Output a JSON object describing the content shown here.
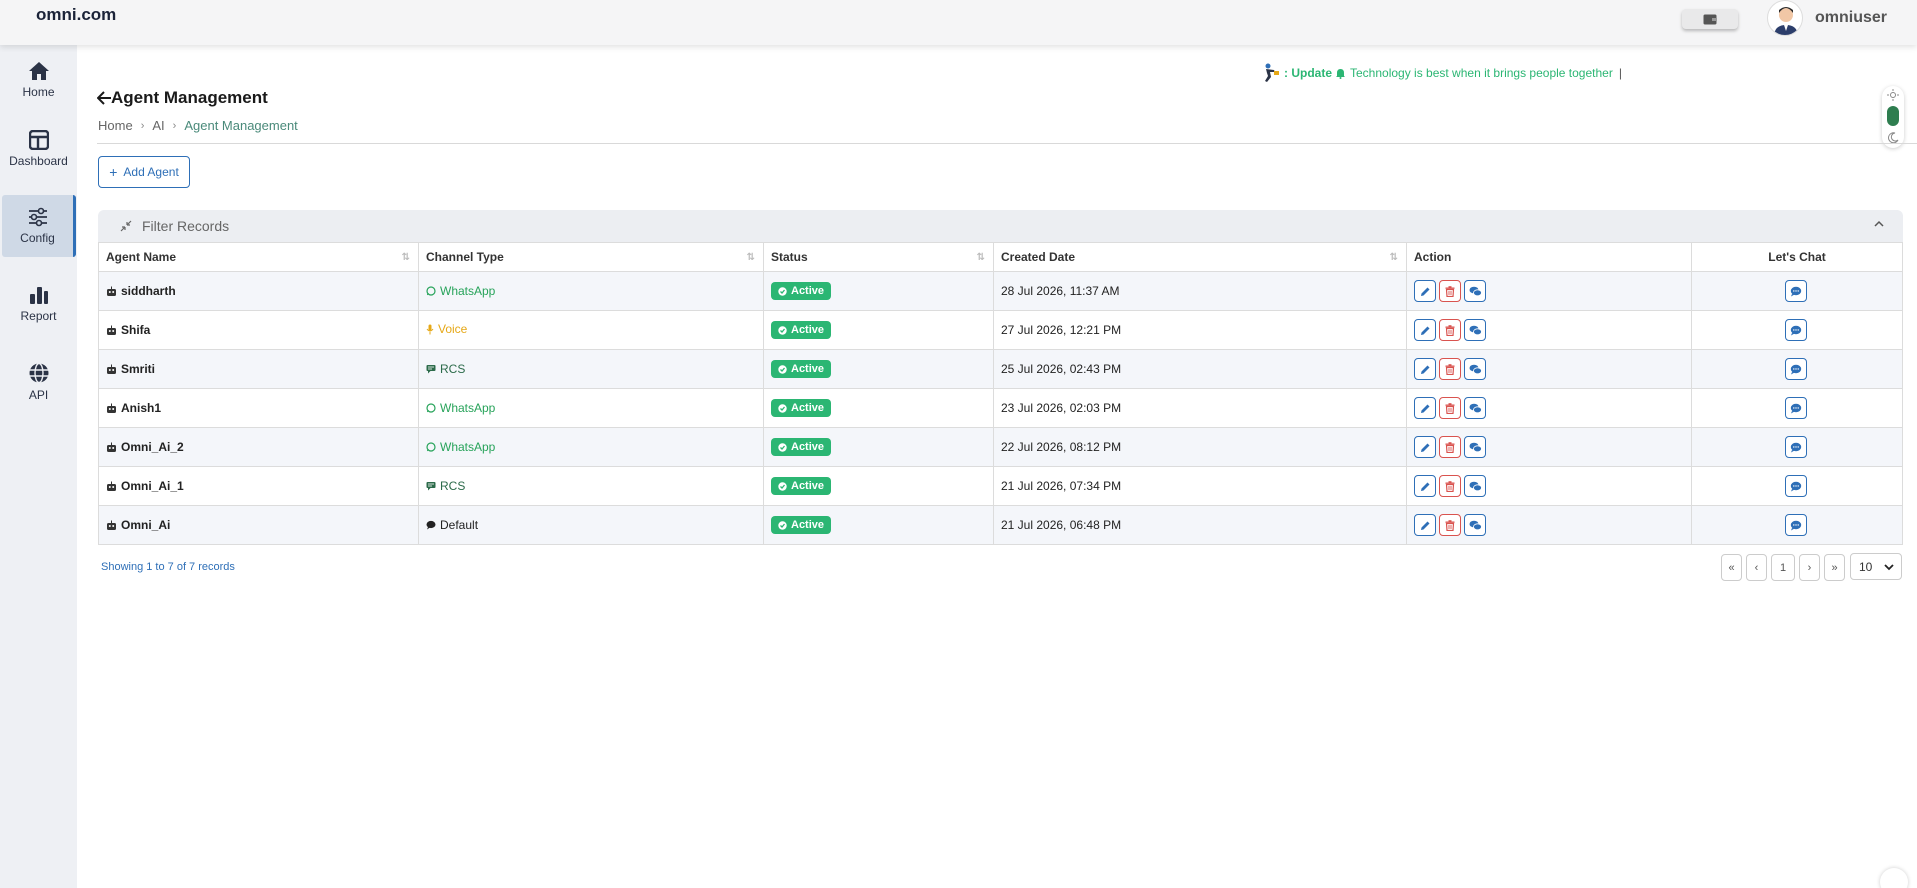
{
  "header": {
    "brand": "omni.com",
    "username": "omniuser"
  },
  "sidebar": {
    "items": [
      {
        "label": "Home",
        "icon": "home-icon"
      },
      {
        "label": "Dashboard",
        "icon": "dashboard-icon"
      },
      {
        "label": "Config",
        "icon": "sliders-icon",
        "active": true
      },
      {
        "label": "Report",
        "icon": "bar-chart-icon"
      },
      {
        "label": "API",
        "icon": "globe-icon"
      }
    ]
  },
  "ticker": {
    "prefix": ": Update",
    "message": "Technology is best when it brings people together",
    "cursor": "|"
  },
  "page": {
    "title": "Agent Management",
    "breadcrumb": [
      "Home",
      "AI",
      "Agent Management"
    ],
    "add_button": "Add Agent",
    "filter_title": "Filter Records"
  },
  "table": {
    "headers": [
      "Agent Name",
      "Channel Type",
      "Status",
      "Created Date",
      "Action",
      "Let's Chat"
    ],
    "rows": [
      {
        "name": "siddharth",
        "channel": "WhatsApp",
        "status": "Active",
        "created": "28 Jul 2026, 11:37 AM"
      },
      {
        "name": "Shifa",
        "channel": "Voice",
        "status": "Active",
        "created": "27 Jul 2026, 12:21 PM"
      },
      {
        "name": "Smriti",
        "channel": "RCS",
        "status": "Active",
        "created": "25 Jul 2026, 02:43 PM"
      },
      {
        "name": "Anish1",
        "channel": "WhatsApp",
        "status": "Active",
        "created": "23 Jul 2026, 02:03 PM"
      },
      {
        "name": "Omni_Ai_2",
        "channel": "WhatsApp",
        "status": "Active",
        "created": "22 Jul 2026, 08:12 PM"
      },
      {
        "name": "Omni_Ai_1",
        "channel": "RCS",
        "status": "Active",
        "created": "21 Jul 2026, 07:34 PM"
      },
      {
        "name": "Omni_Ai",
        "channel": "Default",
        "status": "Active",
        "created": "21 Jul 2026, 06:48 PM"
      }
    ]
  },
  "footer": {
    "showing": "Showing 1 to 7 of 7 records",
    "pager": {
      "first": "«",
      "prev": "‹",
      "page": "1",
      "next": "›",
      "last": "»"
    },
    "per_page": "10"
  },
  "colors": {
    "primary": "#2e6fb7",
    "success": "#2bb673",
    "danger": "#d9534f",
    "voice": "#e6a817"
  }
}
